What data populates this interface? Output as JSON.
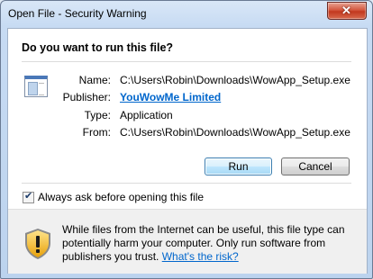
{
  "window": {
    "title": "Open File - Security Warning",
    "close_glyph": "✕"
  },
  "dialog": {
    "heading": "Do you want to run this file?",
    "file_icon": "application-window-icon",
    "details": {
      "name_label": "Name:",
      "name_value": "C:\\Users\\Robin\\Downloads\\WowApp_Setup.exe",
      "publisher_label": "Publisher:",
      "publisher_value": "YouWowMe Limited",
      "type_label": "Type:",
      "type_value": "Application",
      "from_label": "From:",
      "from_value": "C:\\Users\\Robin\\Downloads\\WowApp_Setup.exe"
    },
    "buttons": {
      "run": "Run",
      "cancel": "Cancel"
    },
    "always_ask": {
      "label": "Always ask before opening this file",
      "checked": true
    },
    "warning": {
      "icon": "warning-shield-icon",
      "text": "While files from the Internet can be useful, this file type can potentially harm your computer. Only run software from publishers you trust.",
      "link": "What's the risk?"
    }
  },
  "colors": {
    "link": "#0066cc",
    "close_button": "#c2381e",
    "default_button": "#3c7fb1"
  }
}
